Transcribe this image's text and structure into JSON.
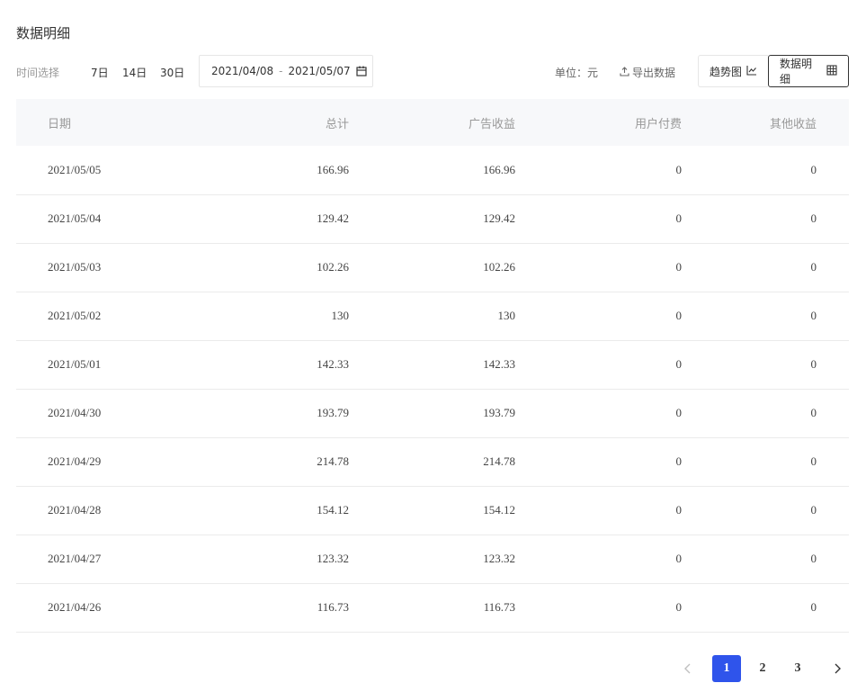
{
  "page": {
    "title": "数据明细"
  },
  "filters": {
    "label": "时间选择",
    "ranges": [
      "7日",
      "14日",
      "30日"
    ],
    "date_start": "2021/04/08",
    "date_sep": "-",
    "date_end": "2021/05/07"
  },
  "unit": "单位：元",
  "export_label": "导出数据",
  "view_toggle": {
    "trend": "趋势图",
    "detail": "数据明细",
    "active": "detail"
  },
  "table": {
    "headers": [
      "日期",
      "总计",
      "广告收益",
      "用户付费",
      "其他收益"
    ],
    "rows": [
      [
        "2021/05/05",
        "166.96",
        "166.96",
        "0",
        "0"
      ],
      [
        "2021/05/04",
        "129.42",
        "129.42",
        "0",
        "0"
      ],
      [
        "2021/05/03",
        "102.26",
        "102.26",
        "0",
        "0"
      ],
      [
        "2021/05/02",
        "130",
        "130",
        "0",
        "0"
      ],
      [
        "2021/05/01",
        "142.33",
        "142.33",
        "0",
        "0"
      ],
      [
        "2021/04/30",
        "193.79",
        "193.79",
        "0",
        "0"
      ],
      [
        "2021/04/29",
        "214.78",
        "214.78",
        "0",
        "0"
      ],
      [
        "2021/04/28",
        "154.12",
        "154.12",
        "0",
        "0"
      ],
      [
        "2021/04/27",
        "123.32",
        "123.32",
        "0",
        "0"
      ],
      [
        "2021/04/26",
        "116.73",
        "116.73",
        "0",
        "0"
      ]
    ]
  },
  "pagination": {
    "pages": [
      "1",
      "2",
      "3"
    ],
    "current": "1"
  },
  "colors": {
    "accent": "#2f54eb",
    "header_bg": "#f7f8fa",
    "border": "#ebebeb"
  }
}
